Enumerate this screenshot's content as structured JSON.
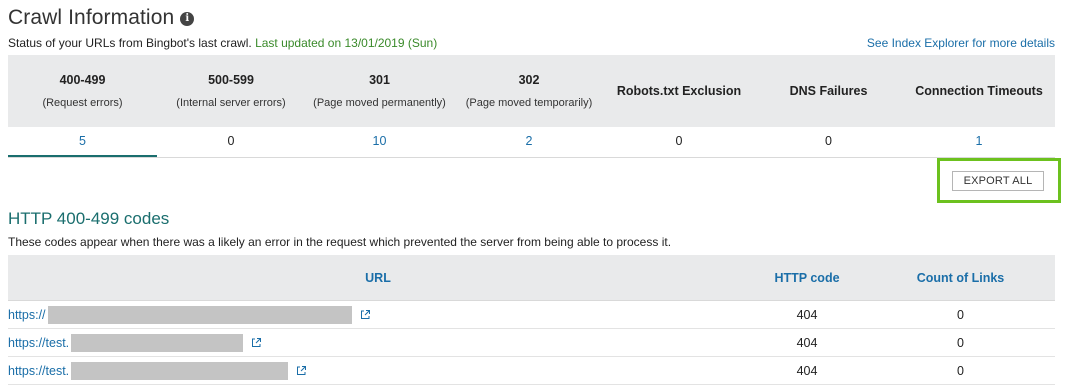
{
  "header": {
    "title": "Crawl Information",
    "info_icon_glyph": "i",
    "status_text": "Status of your URLs from Bingbot's last crawl.",
    "last_updated": "Last updated on 13/01/2019 (Sun)",
    "index_link": "See Index Explorer for more details"
  },
  "summary": {
    "columns": [
      {
        "code": "400-499",
        "desc": "(Request errors)",
        "value": "5"
      },
      {
        "code": "500-599",
        "desc": "(Internal server errors)",
        "value": "0"
      },
      {
        "code": "301",
        "desc": "(Page moved permanently)",
        "value": "10"
      },
      {
        "code": "302",
        "desc": "(Page moved temporarily)",
        "value": "2"
      },
      {
        "code": "Robots.txt Exclusion",
        "desc": "",
        "value": "0"
      },
      {
        "code": "DNS Failures",
        "desc": "",
        "value": "0"
      },
      {
        "code": "Connection Timeouts",
        "desc": "",
        "value": "1"
      }
    ]
  },
  "export": {
    "label": "EXPORT ALL"
  },
  "section": {
    "title": "HTTP 400-499 codes",
    "description": "These codes appear when there was a likely an error in the request which prevented the server from being able to process it."
  },
  "table": {
    "headers": {
      "url": "URL",
      "code": "HTTP code",
      "count": "Count of Links"
    },
    "rows": [
      {
        "url_prefix": "https://",
        "code": "404",
        "count": "0"
      },
      {
        "url_prefix": "https://test.",
        "code": "404",
        "count": "0"
      },
      {
        "url_prefix": "https://test.",
        "code": "404",
        "count": "0"
      }
    ]
  },
  "colors": {
    "link": "#1a6ea8",
    "updated": "#3a8a2a",
    "section_title": "#1a6e6e",
    "header_bg": "#e9eaeb",
    "highlight": "#6cc11e"
  }
}
